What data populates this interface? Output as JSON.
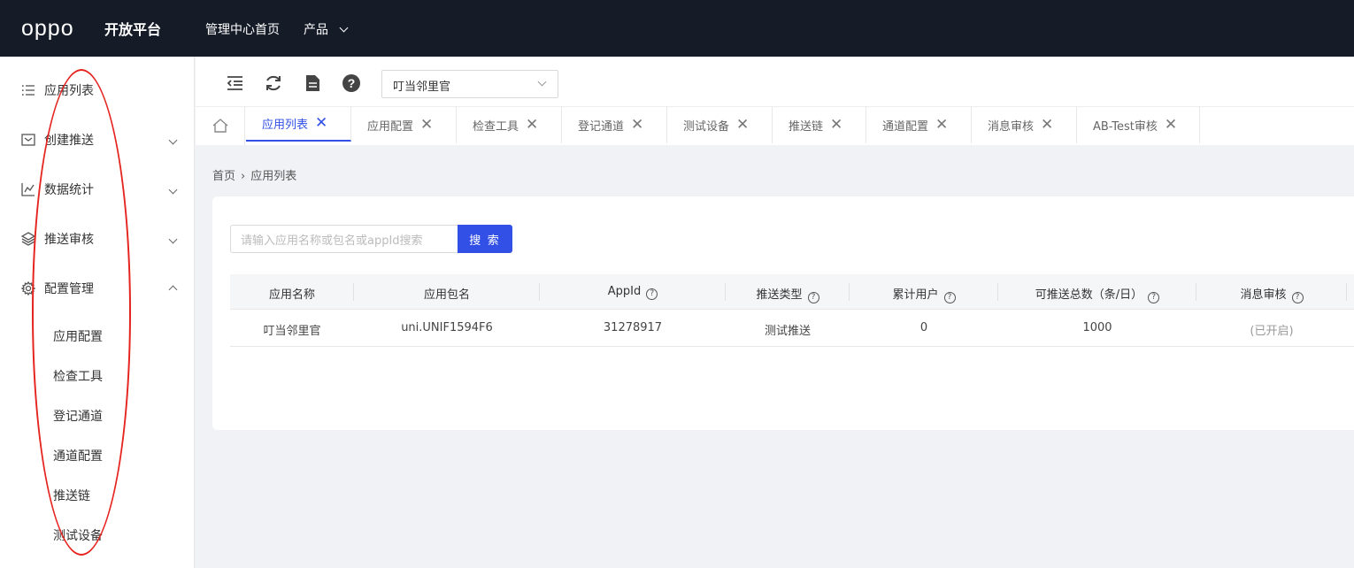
{
  "header": {
    "logo": "oppo",
    "platform": "开放平台",
    "nav_home": "管理中心首页",
    "nav_product": "产品"
  },
  "sidebar": {
    "items": [
      {
        "label": "应用列表",
        "icon": "list-icon"
      },
      {
        "label": "创建推送",
        "icon": "mail-icon"
      },
      {
        "label": "数据统计",
        "icon": "chart-icon"
      },
      {
        "label": "推送审核",
        "icon": "layers-icon"
      },
      {
        "label": "配置管理",
        "icon": "gear-icon"
      }
    ],
    "subitems": [
      "应用配置",
      "检查工具",
      "登记通道",
      "通道配置",
      "推送链",
      "测试设备"
    ]
  },
  "toolbar": {
    "app_select": "叮当邻里官"
  },
  "tabs": [
    {
      "label": "应用列表",
      "active": true
    },
    {
      "label": "应用配置"
    },
    {
      "label": "检查工具"
    },
    {
      "label": "登记通道"
    },
    {
      "label": "测试设备"
    },
    {
      "label": "推送链"
    },
    {
      "label": "通道配置"
    },
    {
      "label": "消息审核"
    },
    {
      "label": "AB-Test审核"
    }
  ],
  "breadcrumb": {
    "home": "首页",
    "current": "应用列表"
  },
  "search": {
    "placeholder": "请输入应用名称或包名或appId搜索",
    "button": "搜 索"
  },
  "table": {
    "headers": [
      "应用名称",
      "应用包名",
      "AppId",
      "推送类型",
      "累计用户",
      "可推送总数（条/日）",
      "消息审核"
    ],
    "rows": [
      [
        "叮当邻里官",
        "uni.UNIF1594F6",
        "31278917",
        "测试推送",
        "0",
        "1000",
        "(已开启)"
      ]
    ]
  },
  "colors": {
    "topbar": "#151c28",
    "accent": "#3350e6",
    "annotation": "#e5231f"
  }
}
